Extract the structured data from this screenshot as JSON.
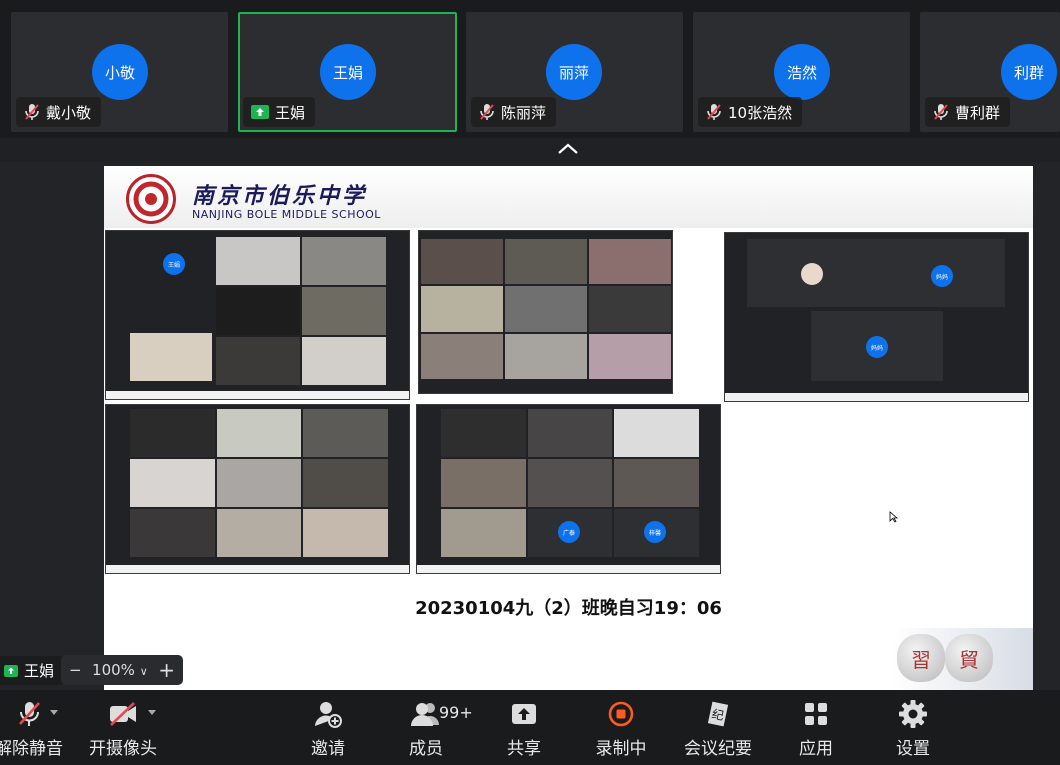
{
  "participants": [
    {
      "avatar_text": "小敬",
      "name": "戴小敬",
      "muted": true
    },
    {
      "avatar_text": "王娟",
      "name": "王娟",
      "muted": false,
      "sharing": true
    },
    {
      "avatar_text": "丽萍",
      "name": "陈丽萍",
      "muted": true
    },
    {
      "avatar_text": "浩然",
      "name": "10张浩然",
      "muted": true
    },
    {
      "avatar_text": "利群",
      "name": "曹利群",
      "muted": true
    }
  ],
  "slide": {
    "school_cn": "南京市伯乐中学",
    "school_en": "NANJING BOLE MIDDLE SCHOOL",
    "caption": "20230104九（2）班晚自习19：06",
    "mini_avatars": [
      "王娟",
      "妈妈",
      "妈妈",
      "广泰",
      "梓馨"
    ],
    "seal_chars": [
      "習",
      "貿"
    ]
  },
  "self_view": {
    "name": "王娟"
  },
  "zoom": {
    "minus": "−",
    "level": "100%",
    "caret": "∨",
    "plus": "+"
  },
  "toolbar": {
    "unmute": "解除静音",
    "start_video": "开摄像头",
    "invite": "邀请",
    "participants": "成员",
    "participants_count": "99+",
    "share": "共享",
    "recording": "录制中",
    "summary": "会议纪要",
    "apps": "应用",
    "settings": "设置"
  },
  "colors": {
    "accent": "#0e72ed",
    "active_border": "#20b354",
    "record": "#ff5a1f"
  }
}
